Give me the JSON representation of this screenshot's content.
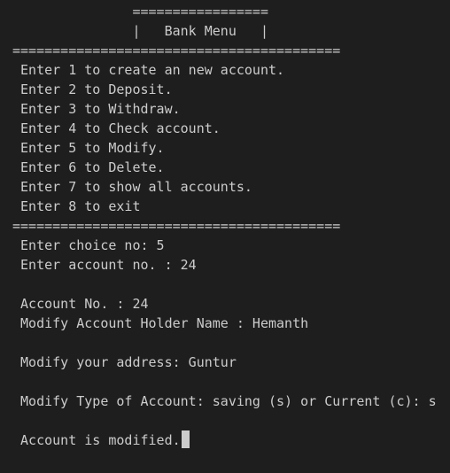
{
  "terminal": {
    "lines": [
      "               =================",
      "               |   Bank Menu   |",
      "=========================================",
      " Enter 1 to create an new account.",
      " Enter 2 to Deposit.",
      " Enter 3 to Withdraw.",
      " Enter 4 to Check account.",
      " Enter 5 to Modify.",
      " Enter 6 to Delete.",
      " Enter 7 to show all accounts.",
      " Enter 8 to exit",
      "=========================================",
      " Enter choice no: 5",
      " Enter account no. : 24",
      "",
      " Account No. : 24",
      " Modify Account Holder Name : Hemanth",
      "",
      " Modify your address: Guntur",
      "",
      " Modify Type of Account: saving (s) or Current (c): s",
      "",
      " Account is modified."
    ],
    "colors": {
      "background": "#1e1e1e",
      "text": "#cccccc"
    }
  }
}
